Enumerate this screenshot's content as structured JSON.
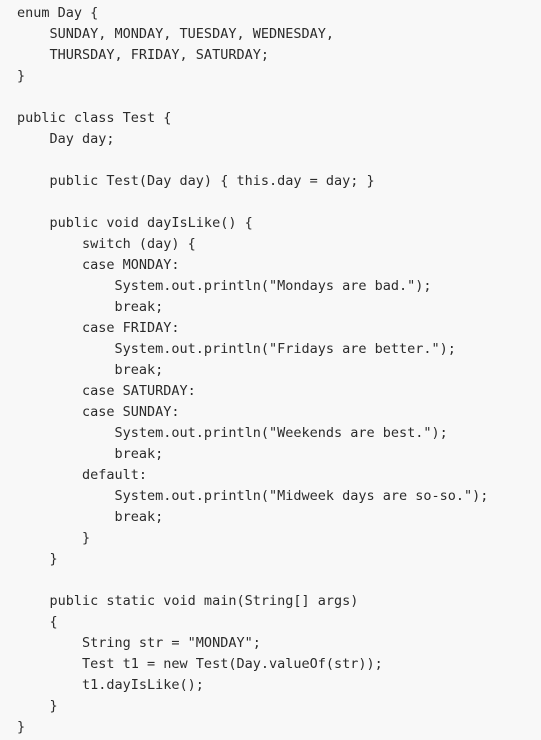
{
  "code": {
    "language": "java",
    "lines": [
      "enum Day {",
      "    SUNDAY, MONDAY, TUESDAY, WEDNESDAY,",
      "    THURSDAY, FRIDAY, SATURDAY;",
      "}",
      "",
      "public class Test {",
      "    Day day;",
      "",
      "    public Test(Day day) { this.day = day; }",
      "",
      "    public void dayIsLike() {",
      "        switch (day) {",
      "        case MONDAY:",
      "            System.out.println(\"Mondays are bad.\");",
      "            break;",
      "        case FRIDAY:",
      "            System.out.println(\"Fridays are better.\");",
      "            break;",
      "        case SATURDAY:",
      "        case SUNDAY:",
      "            System.out.println(\"Weekends are best.\");",
      "            break;",
      "        default:",
      "            System.out.println(\"Midweek days are so-so.\");",
      "            break;",
      "        }",
      "    }",
      "",
      "    public static void main(String[] args)",
      "    {",
      "        String str = \"MONDAY\";",
      "        Test t1 = new Test(Day.valueOf(str));",
      "        t1.dayIsLike();",
      "    }",
      "}"
    ]
  }
}
